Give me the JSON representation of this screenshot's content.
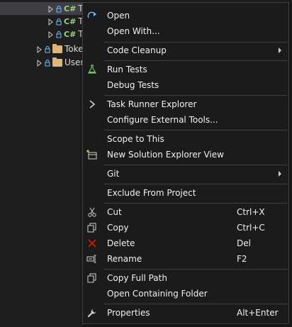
{
  "tree": {
    "rows": [
      {
        "label": "T",
        "type": "cs-file"
      },
      {
        "label": "T",
        "type": "cs-file"
      },
      {
        "label": "T",
        "type": "cs-file"
      },
      {
        "label": "Toke",
        "type": "folder"
      },
      {
        "label": "User",
        "type": "folder"
      }
    ],
    "cs_badge": "C#"
  },
  "menu": {
    "items": {
      "open": {
        "label": "Open",
        "icon": "open-arrow-icon"
      },
      "open_with": {
        "label": "Open With..."
      },
      "code_cleanup": {
        "label": "Code Cleanup"
      },
      "run_tests": {
        "label": "Run Tests",
        "icon": "flask-icon"
      },
      "debug_tests": {
        "label": "Debug Tests"
      },
      "task_runner": {
        "label": "Task Runner Explorer",
        "icon": "chevron-right-icon"
      },
      "configure_tools": {
        "label": "Configure External Tools..."
      },
      "scope_to_this": {
        "label": "Scope to This"
      },
      "new_se_view": {
        "label": "New Solution Explorer View",
        "icon": "new-view-icon"
      },
      "git": {
        "label": "Git"
      },
      "exclude": {
        "label": "Exclude From Project"
      },
      "cut": {
        "label": "Cut",
        "shortcut": "Ctrl+X",
        "icon": "scissors-icon"
      },
      "copy": {
        "label": "Copy",
        "shortcut": "Ctrl+C",
        "icon": "copy-icon"
      },
      "delete": {
        "label": "Delete",
        "shortcut": "Del",
        "icon": "delete-x-icon"
      },
      "rename": {
        "label": "Rename",
        "shortcut": "F2",
        "icon": "rename-icon"
      },
      "copy_full_path": {
        "label": "Copy Full Path",
        "icon": "copy-path-icon"
      },
      "open_folder": {
        "label": "Open Containing Folder"
      },
      "properties": {
        "label": "Properties",
        "shortcut": "Alt+Enter",
        "icon": "wrench-icon"
      }
    }
  },
  "colors": {
    "background": "#1e1e1e",
    "menu_background": "#1b1b1c",
    "menu_border": "#3f3f46",
    "text": "#f1f1f1",
    "csharp_green": "#9ad27a",
    "delete_red": "#e51400",
    "accent_blue": "#75beff",
    "folder": "#dcb67a"
  }
}
